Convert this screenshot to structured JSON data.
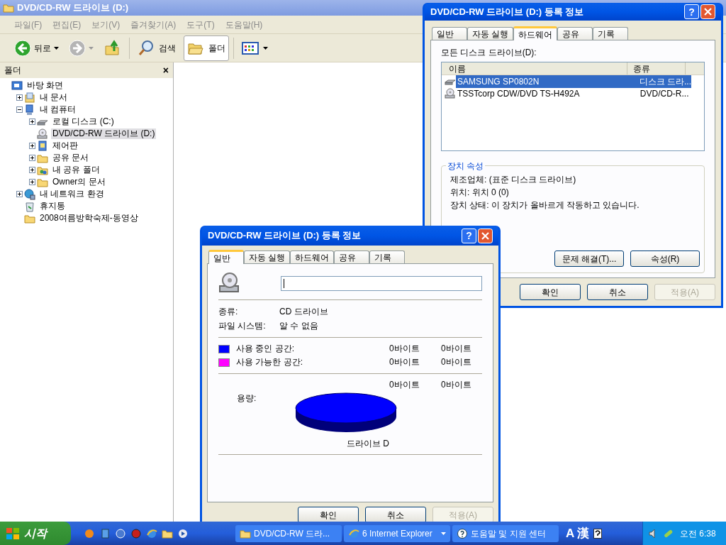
{
  "explorer": {
    "title": "DVD/CD-RW 드라이브 (D:)",
    "menu": [
      "파일(F)",
      "편집(E)",
      "보기(V)",
      "즐겨찾기(A)",
      "도구(T)",
      "도움말(H)"
    ],
    "toolbar": [
      {
        "kind": "back",
        "label": "뒤로",
        "disabled": false
      },
      {
        "kind": "forward",
        "disabled": true
      },
      {
        "kind": "up"
      },
      {
        "kind": "search",
        "label": "검색",
        "selected": false
      },
      {
        "kind": "folders",
        "label": "폴더",
        "selected": true
      },
      {
        "kind": "views"
      }
    ],
    "folder_pane": {
      "title": "폴더",
      "close": "×",
      "tree": [
        {
          "label": "바탕 화면",
          "kind": "desktop",
          "expandable": false,
          "selected": false,
          "children": [
            {
              "label": "내 문서",
              "kind": "documents",
              "expandable": true,
              "expanded": false,
              "selected": false
            },
            {
              "label": "내 컴퓨터",
              "kind": "computer",
              "expandable": true,
              "expanded": true,
              "selected": false,
              "children": [
                {
                  "label": "로컬 디스크 (C:)",
                  "kind": "harddisk",
                  "expandable": true,
                  "expanded": false,
                  "selected": false
                },
                {
                  "label": "DVD/CD-RW 드라이브 (D:)",
                  "kind": "cdrom",
                  "expandable": false,
                  "selected": true
                },
                {
                  "label": "제어판",
                  "kind": "controlpanel",
                  "expandable": true,
                  "expanded": false,
                  "selected": false
                },
                {
                  "label": "공유 문서",
                  "kind": "folder",
                  "expandable": true,
                  "expanded": false,
                  "selected": false
                },
                {
                  "label": "내 공유 폴더",
                  "kind": "sharedfolder",
                  "expandable": true,
                  "expanded": false,
                  "selected": false
                },
                {
                  "label": "Owner의 문서",
                  "kind": "folder",
                  "expandable": true,
                  "expanded": false,
                  "selected": false
                }
              ]
            },
            {
              "label": "내 네트워크 환경",
              "kind": "network",
              "expandable": true,
              "expanded": false,
              "selected": false
            },
            {
              "label": "휴지통",
              "kind": "recyclebin",
              "expandable": false,
              "selected": false
            },
            {
              "label": "2008여름방학숙제-동영상",
              "kind": "folder",
              "expandable": false,
              "selected": false
            }
          ]
        }
      ]
    }
  },
  "hardware_dialog": {
    "title": "DVD/CD-RW 드라이브 (D:) 등록 정보",
    "help": "?",
    "tabs": [
      {
        "label": "일반",
        "selected": false
      },
      {
        "label": "자동 실행",
        "selected": false
      },
      {
        "label": "하드웨어",
        "selected": true
      },
      {
        "label": "공유",
        "selected": false
      },
      {
        "label": "기록",
        "selected": false
      }
    ],
    "list_label": "모든 디스크 드라이브(D):",
    "columns": [
      "이름",
      "종류"
    ],
    "rows": [
      {
        "name": "SAMSUNG SP0802N",
        "type": "디스크 드라...",
        "kind": "harddisk",
        "selected": true
      },
      {
        "name": "TSSTcorp CDW/DVD TS-H492A",
        "type": "DVD/CD-R...",
        "kind": "cdrom",
        "selected": false
      }
    ],
    "group_title": "장치 속성",
    "properties": [
      "제조업체: (표준 디스크 드라이브)",
      "위치: 위치 0 (0)",
      "장치 상태: 이 장치가 올바르게 작동하고 있습니다."
    ],
    "group_buttons": [
      "문제 해결(T)...",
      "속성(R)"
    ],
    "buttons": [
      {
        "label": "확인",
        "disabled": false
      },
      {
        "label": "취소",
        "disabled": false
      },
      {
        "label": "적용(A)",
        "disabled": true
      }
    ]
  },
  "general_dialog": {
    "title": "DVD/CD-RW 드라이브 (D:) 등록 정보",
    "help": "?",
    "tabs": [
      {
        "label": "일반",
        "selected": true
      },
      {
        "label": "자동 실행",
        "selected": false
      },
      {
        "label": "하드웨어",
        "selected": false
      },
      {
        "label": "공유",
        "selected": false
      },
      {
        "label": "기록",
        "selected": false
      }
    ],
    "info": [
      {
        "label": "종류:",
        "value": "CD 드라이브"
      },
      {
        "label": "파일 시스템:",
        "value": "알 수 없음"
      }
    ],
    "space": [
      {
        "label": "사용 중인 공간:",
        "color": "#0000ff",
        "bytes": "0바이트",
        "size": "0바이트"
      },
      {
        "label": "사용 가능한 공간:",
        "color": "#ff00ff",
        "bytes": "0바이트",
        "size": "0바이트"
      }
    ],
    "capacity": {
      "label": "용량:",
      "bytes": "0바이트",
      "size": "0바이트"
    },
    "drive_label": "드라이브 D",
    "buttons": [
      {
        "label": "확인",
        "disabled": false
      },
      {
        "label": "취소",
        "disabled": false
      },
      {
        "label": "적용(A)",
        "disabled": true
      }
    ]
  },
  "taskbar": {
    "start": "시작",
    "quick_launch": [
      {
        "kind": "media"
      },
      {
        "kind": "notepad"
      },
      {
        "kind": "browser"
      },
      {
        "kind": "music"
      },
      {
        "kind": "ie"
      },
      {
        "kind": "folder"
      },
      {
        "kind": "player"
      }
    ],
    "tasks": [
      {
        "label": "DVD/CD-RW 드라...",
        "kind": "folder",
        "selected": false,
        "group": false
      },
      {
        "label": "6 Internet Explorer",
        "kind": "ie",
        "selected": false,
        "group": true
      },
      {
        "label": "도움말 및 지원 센터",
        "kind": "help",
        "selected": false,
        "group": false
      }
    ],
    "language": "A 漢",
    "clock": "오전 6:38"
  }
}
